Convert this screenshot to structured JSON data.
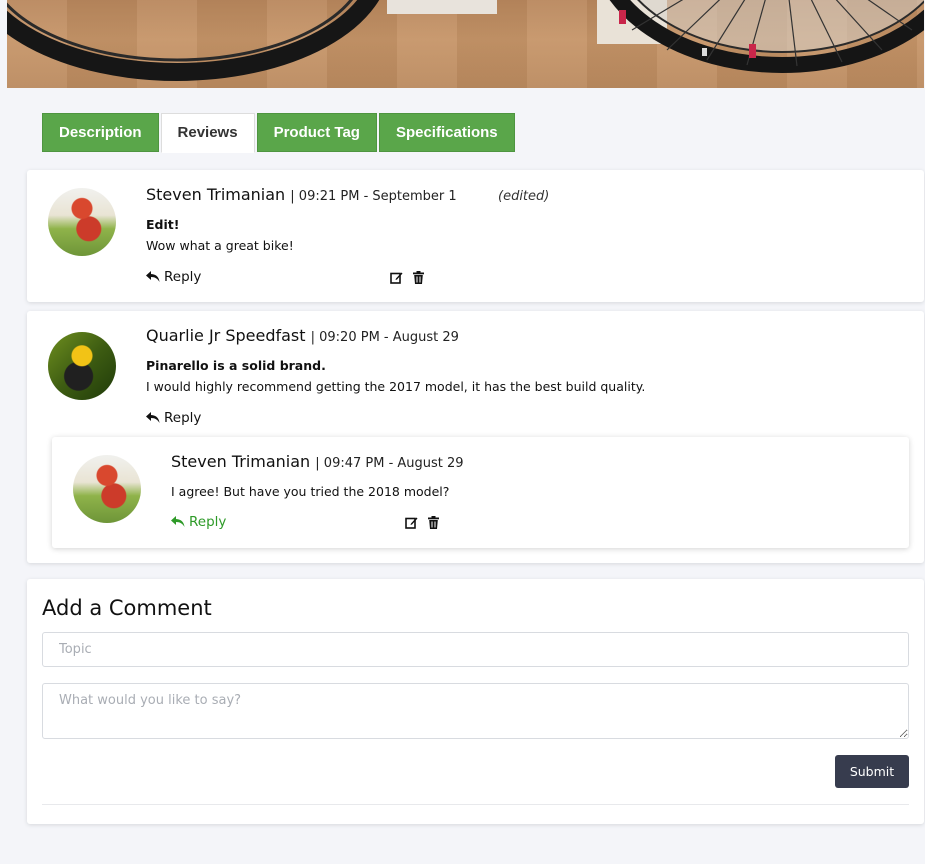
{
  "tabs": [
    {
      "label": "Description",
      "active": false
    },
    {
      "label": "Reviews",
      "active": true
    },
    {
      "label": "Product Tag",
      "active": false
    },
    {
      "label": "Specifications",
      "active": false
    }
  ],
  "comments": [
    {
      "author": "Steven Trimanian",
      "meta": "| 09:21 PM - September 1",
      "edited": "(edited)",
      "topic": "Edit!",
      "text": "Wow what a great bike!",
      "reply_label": "Reply"
    },
    {
      "author": "Quarlie Jr Speedfast",
      "meta": "| 09:20 PM - August 29",
      "topic": "Pinarello is a solid brand.",
      "text": "I would highly recommend getting the 2017 model, it has the best build quality.",
      "reply_label": "Reply",
      "replies": [
        {
          "author": "Steven Trimanian",
          "meta": "| 09:47 PM - August 29",
          "text": "I agree! But have you tried the 2018 model?",
          "reply_label": "Reply"
        }
      ]
    }
  ],
  "form": {
    "title": "Add a Comment",
    "topic_placeholder": "Topic",
    "message_placeholder": "What would you like to say?",
    "submit_label": "Submit"
  },
  "colors": {
    "tab_green": "#5aa64a",
    "reply_green": "#2e9a28",
    "submit_bg": "#373c4e",
    "page_bg": "#f4f5f9"
  }
}
